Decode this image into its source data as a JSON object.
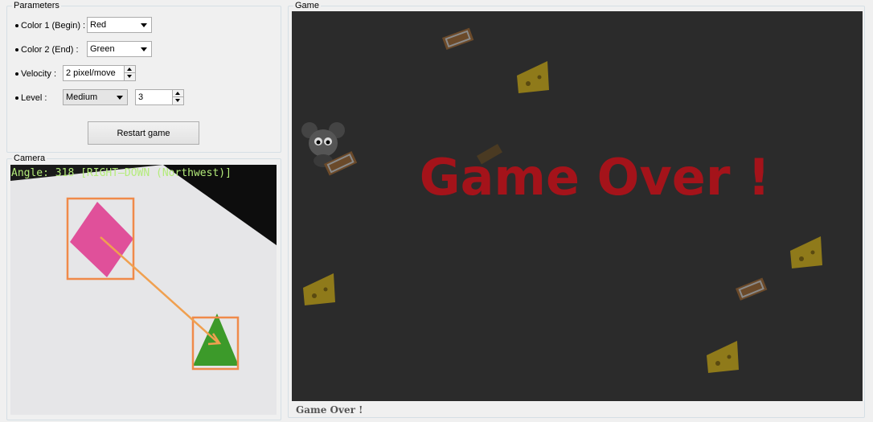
{
  "parameters": {
    "title": "Parameters",
    "color1_label": "Color 1 (Begin) :",
    "color1_value": "Red",
    "color2_label": "Color 2 (End) :",
    "color2_value": "Green",
    "velocity_label": "Velocity :",
    "velocity_value": "2  pixel/move",
    "level_label": "Level :",
    "level_value": "Medium",
    "level_number": "3",
    "restart_label": "Restart game"
  },
  "camera": {
    "title": "Camera",
    "angle_text": "Angle: 318 [RIGHT—DOWN (Northwest)]",
    "colors": {
      "frame": "#e8e8ea",
      "pink": "#e0509a",
      "green": "#3c9a2a",
      "box": "#f08a4a",
      "arrow": "#f0a050"
    }
  },
  "game": {
    "title": "Game",
    "game_over_text": "Game Over !",
    "status_text": "Game Over !",
    "colors": {
      "background": "#2b2b2b",
      "game_over": "#a4131a"
    },
    "sprites": [
      "mousetrap-icon",
      "cheese-icon",
      "mouse-icon"
    ]
  }
}
